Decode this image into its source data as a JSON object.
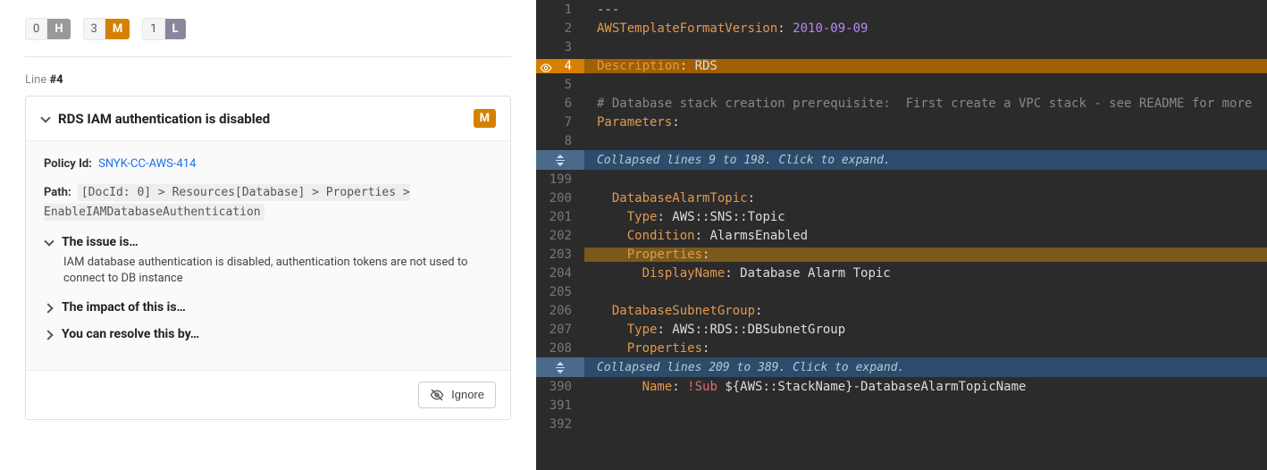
{
  "severity": {
    "h": {
      "count": "0",
      "label": "H"
    },
    "m": {
      "count": "3",
      "label": "M"
    },
    "l": {
      "count": "1",
      "label": "L"
    }
  },
  "line_marker": {
    "prefix": "Line ",
    "value": "#4"
  },
  "issue": {
    "title": "RDS IAM authentication is disabled",
    "severity_badge": "M",
    "policy_label": "Policy Id:",
    "policy_id": "SNYK-CC-AWS-414",
    "path_label": "Path:",
    "path": "[DocId: 0] > Resources[Database] > Properties > EnableIAMDatabaseAuthentication",
    "sections": {
      "issue_is": {
        "title": "The issue is…",
        "body": "IAM database authentication is disabled, authentication tokens are not used to connect to DB instance"
      },
      "impact": {
        "title": "The impact of this is…"
      },
      "resolve": {
        "title": "You can resolve this by…"
      }
    },
    "ignore_label": "Ignore"
  },
  "code": {
    "lines": [
      {
        "n": 1,
        "t": "dash",
        "txt": "---"
      },
      {
        "n": 2,
        "t": "kv",
        "key": "AWSTemplateFormatVersion",
        "val": "2010-09-09",
        "valClass": "tk-date"
      },
      {
        "n": 3,
        "t": "blank"
      },
      {
        "n": 4,
        "t": "kv",
        "key": "Description",
        "val": "RDS",
        "hl": "orange",
        "eye": true
      },
      {
        "n": 5,
        "t": "blank"
      },
      {
        "n": 6,
        "t": "comment",
        "txt": "# Database stack creation prerequisite:  First create a VPC stack - see README for more"
      },
      {
        "n": 7,
        "t": "key",
        "key": "Parameters",
        "indent": 0
      },
      {
        "n": 8,
        "t": "blank"
      }
    ],
    "collapse1": "Collapsed lines 9 to 198. Click to expand.",
    "lines2": [
      {
        "n": 199,
        "t": "blank"
      },
      {
        "n": 200,
        "t": "key",
        "key": "DatabaseAlarmTopic",
        "indent": 2
      },
      {
        "n": 201,
        "t": "kv",
        "key": "Type",
        "val": "AWS::SNS::Topic",
        "indent": 4
      },
      {
        "n": 202,
        "t": "kv",
        "key": "Condition",
        "val": "AlarmsEnabled",
        "indent": 4
      },
      {
        "n": 203,
        "t": "key",
        "key": "Properties",
        "indent": 4,
        "hl": "brown"
      },
      {
        "n": 204,
        "t": "kv",
        "key": "DisplayName",
        "val": "Database Alarm Topic",
        "indent": 6
      },
      {
        "n": 205,
        "t": "blank"
      },
      {
        "n": 206,
        "t": "key",
        "key": "DatabaseSubnetGroup",
        "indent": 2
      },
      {
        "n": 207,
        "t": "kv",
        "key": "Type",
        "val": "AWS::RDS::DBSubnetGroup",
        "indent": 4
      },
      {
        "n": 208,
        "t": "key",
        "key": "Properties",
        "indent": 4
      }
    ],
    "collapse2": "Collapsed lines 209 to 389. Click to expand.",
    "lines3": [
      {
        "n": 390,
        "t": "sub",
        "key": "Name",
        "bang": "!Sub",
        "val": "${AWS::StackName}-DatabaseAlarmTopicName",
        "indent": 6
      },
      {
        "n": 391,
        "t": "blank"
      },
      {
        "n": 392,
        "t": "blank"
      }
    ]
  }
}
